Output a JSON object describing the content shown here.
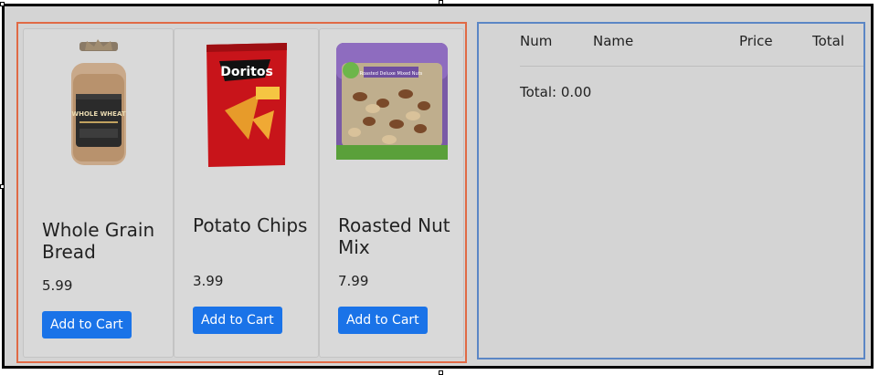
{
  "products": [
    {
      "name": "Whole Grain Bread",
      "price": "5.99",
      "button": "Add to Cart",
      "image_icon": "bread-loaf-image",
      "bag_label": "WHOLE WHEAT"
    },
    {
      "name": "Potato Chips",
      "price": "3.99",
      "button": "Add to Cart",
      "image_icon": "chips-bag-image",
      "bag_label": "Doritos"
    },
    {
      "name": "Roasted Nut Mix",
      "price": "7.99",
      "button": "Add to Cart",
      "image_icon": "nut-mix-bag-image",
      "bag_label": "Roasted Deluxe Mixed Nuts"
    }
  ],
  "cart": {
    "columns": [
      "Num",
      "Name",
      "Price",
      "Total"
    ],
    "total_label": "Total: 0.00"
  },
  "colors": {
    "products_border": "#e06a45",
    "cart_border": "#5b86c5",
    "button_bg": "#1a73e8",
    "panel_bg": "#d4d4d4"
  }
}
